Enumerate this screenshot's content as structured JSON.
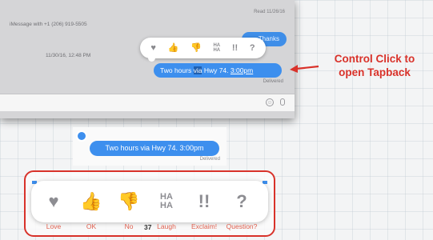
{
  "messages_window": {
    "read_receipt": "Read 11/26/16",
    "imessage_label": "iMessage with +1 (206) 919-5505",
    "previous_bubble": "Thanks",
    "timestamp": "11/30/16, 12:48 PM",
    "message": {
      "before": "Two hours ",
      "selected": "via",
      "middle": " Hwy 74. ",
      "link": "3:00pm"
    },
    "status": "Delivered",
    "tapback_icons": [
      "heart-icon",
      "thumbs-up-icon",
      "thumbs-down-icon",
      "haha-icon",
      "double-exclamation-icon",
      "question-mark-icon"
    ]
  },
  "callout": {
    "line1": "Control Click to",
    "line2": "open Tapback",
    "color": "#d9322a"
  },
  "tapped_bubble": {
    "text": "Two hours via Hwy 74. 3:00pm",
    "status": "Delivered"
  },
  "legend": {
    "items": [
      {
        "icon": "heart-icon",
        "glyph": "♥",
        "label": "Love"
      },
      {
        "icon": "thumbs-up-icon",
        "glyph": "👍",
        "label": "OK"
      },
      {
        "icon": "thumbs-down-icon",
        "glyph": "👎",
        "label": "No"
      },
      {
        "icon": "haha-icon",
        "glyph_top": "HA",
        "glyph_bottom": "HA",
        "label": "Laugh"
      },
      {
        "icon": "double-exclamation-icon",
        "glyph": "!!",
        "label": "Exclaim!"
      },
      {
        "icon": "question-mark-icon",
        "glyph": "?",
        "label": "Question?"
      }
    ],
    "page_number": "37",
    "border_color": "#d8322a"
  },
  "colors": {
    "bubble_blue": "#3d8fee",
    "accent_red": "#d9322a"
  }
}
